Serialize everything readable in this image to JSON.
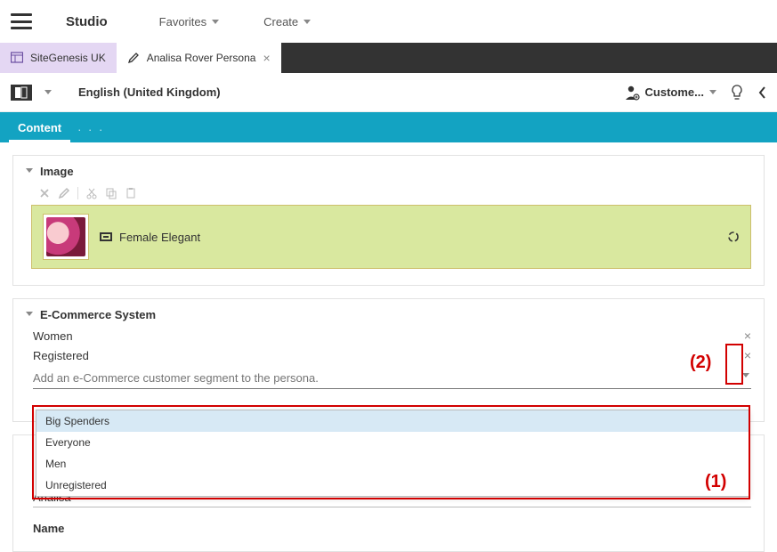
{
  "topbar": {
    "title": "Studio",
    "menu": [
      {
        "label": "Favorites"
      },
      {
        "label": "Create"
      }
    ]
  },
  "tabs": {
    "site": {
      "label": "SiteGenesis UK"
    },
    "persona": {
      "label": "Analisa Rover Persona"
    }
  },
  "contextbar": {
    "locale_label": "English (United Kingdom)",
    "customer_label": "Custome..."
  },
  "bluebar": {
    "content_tab": "Content"
  },
  "image_section": {
    "header": "Image",
    "item_label": "Female Elegant"
  },
  "ecom_section": {
    "header": "E-Commerce System",
    "segments": [
      {
        "label": "Women"
      },
      {
        "label": "Registered"
      }
    ],
    "input_placeholder": "Add an e-Commerce customer segment to the persona.",
    "dropdown": [
      "Big Spenders",
      "Everyone",
      "Men",
      "Unregistered"
    ]
  },
  "card3": {
    "value": "Analisa",
    "name_label": "Name"
  },
  "annotations": {
    "one": "(1)",
    "two": "(2)"
  }
}
